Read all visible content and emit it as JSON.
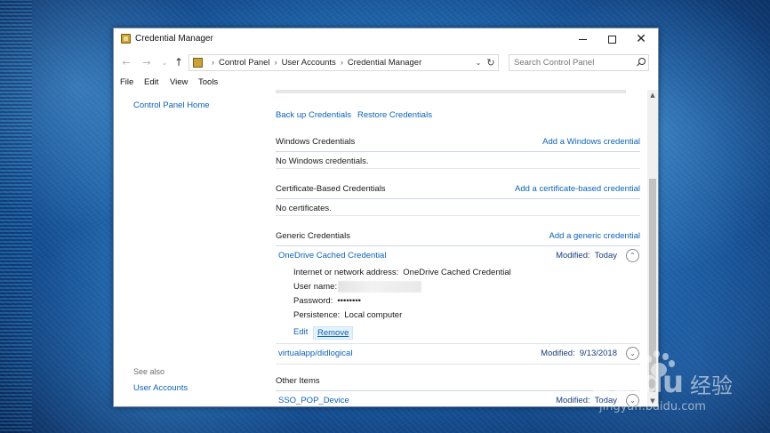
{
  "window": {
    "title": "Credential Manager",
    "minimize": "—",
    "maximize": "☐",
    "close": "✕"
  },
  "nav": {
    "back": "←",
    "forward": "→",
    "recent": "⌄",
    "up": "↑",
    "breadcrumbs": [
      "Control Panel",
      "User Accounts",
      "Credential Manager"
    ],
    "separator": "›",
    "address_drop": "⌄",
    "refresh": "↻",
    "search_placeholder": "Search Control Panel"
  },
  "menu": {
    "file": "File",
    "edit": "Edit",
    "view": "View",
    "tools": "Tools"
  },
  "left_pane": {
    "home": "Control Panel Home",
    "see_also": "See also",
    "user_accounts": "User Accounts"
  },
  "main": {
    "backup": "Back up Credentials",
    "restore": "Restore Credentials",
    "windows": {
      "title": "Windows Credentials",
      "action": "Add a Windows credential",
      "empty": "No Windows credentials."
    },
    "certificate": {
      "title": "Certificate-Based Credentials",
      "action": "Add a certificate-based credential",
      "empty": "No certificates."
    },
    "generic": {
      "title": "Generic Credentials",
      "action": "Add a generic credential",
      "items": [
        {
          "name": "OneDrive Cached Credential",
          "modified_label": "Modified:",
          "modified": "Today",
          "chevron": "⌃",
          "details": {
            "address_label": "Internet or network address:",
            "address": "OneDrive Cached Credential",
            "username_label": "User name:",
            "password_label": "Password:",
            "password": "••••••••",
            "persistence_label": "Persistence:",
            "persistence": "Local computer",
            "edit": "Edit",
            "remove": "Remove"
          }
        },
        {
          "name": "virtualapp/didlogical",
          "modified_label": "Modified:",
          "modified": "9/13/2018",
          "chevron": "⌄"
        }
      ]
    },
    "other": {
      "title": "Other Items",
      "items": [
        {
          "name": "SSO_POP_Device",
          "modified_label": "Modified:",
          "modified": "Today",
          "chevron": "⌄"
        }
      ]
    }
  },
  "scrollbar": {
    "up": "▲",
    "down": "▼"
  },
  "watermark": {
    "logo": "Bai",
    "logo_tail": "du",
    "cn": "经验",
    "url": "jingyan.baidu.com"
  }
}
